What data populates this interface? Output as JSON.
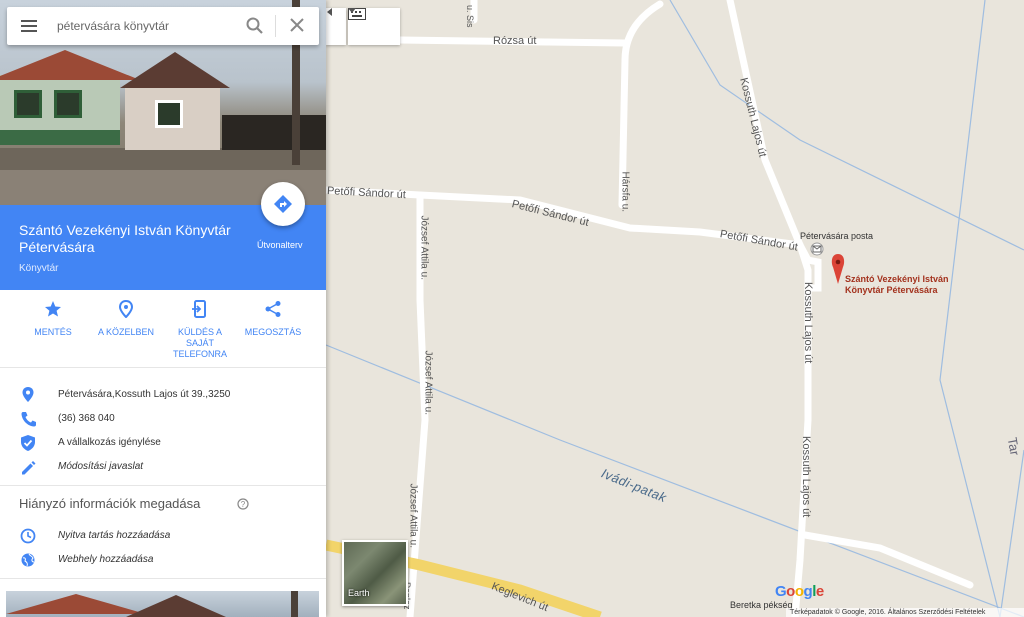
{
  "search": {
    "query": "pétervására könyvtár"
  },
  "place": {
    "name": "Szántó Vezekényi István Könyvtár Pétervására",
    "type": "Könyvtár",
    "route_label": "Útvonalterv"
  },
  "actions": [
    {
      "label": "MENTÉS",
      "icon": "star-icon"
    },
    {
      "label": "A KÖZELBEN",
      "icon": "nearby-icon"
    },
    {
      "label": "KÜLDÉS A SAJÁT TELEFONRA",
      "icon": "send-to-phone-icon"
    },
    {
      "label": "MEGOSZTÁS",
      "icon": "share-icon"
    }
  ],
  "info": {
    "address": "Pétervására,Kossuth Lajos út 39.,3250",
    "phone": "(36) 368 040",
    "claim": "A vállalkozás igénylése",
    "suggest": "Módosítási javaslat"
  },
  "missing": {
    "title": "Hiányzó információk megadása",
    "hours": "Nyitva tartás hozzáadása",
    "website": "Webhely hozzáadása"
  },
  "map": {
    "roads": {
      "rozsa": "Rózsa út",
      "petofi1": "Petőfi Sándor út",
      "petofi2": "Petőfi Sándor út",
      "petofi3": "Petőfi Sándor út",
      "harsfa": "Hársfa u.",
      "jozsef1": "József Attila u.",
      "jozsef2": "József Attila u.",
      "jozsef3": "József Attila u.",
      "kossuth1": "Kossuth Lajos út",
      "kossuth2": "Kossuth Lajos út",
      "kossuth3": "Kossuth Lajos út",
      "keglevich": "Keglevich út",
      "paplaz": "Paplaz",
      "sis": "u. Sis",
      "tar": "Tar"
    },
    "water": "Ivádi-patak",
    "poi_post": "Pétervására posta",
    "pin_label": "Szántó Vezekényi István Könyvtár Pétervására",
    "bakery": "Beretka pékség",
    "earth": "Earth",
    "google": "Google",
    "footer": "Térképadatok © Google, 2016.    Általános Szerződési Feltételek",
    "accent": "#4285f4",
    "pin_color": "#db4437"
  }
}
